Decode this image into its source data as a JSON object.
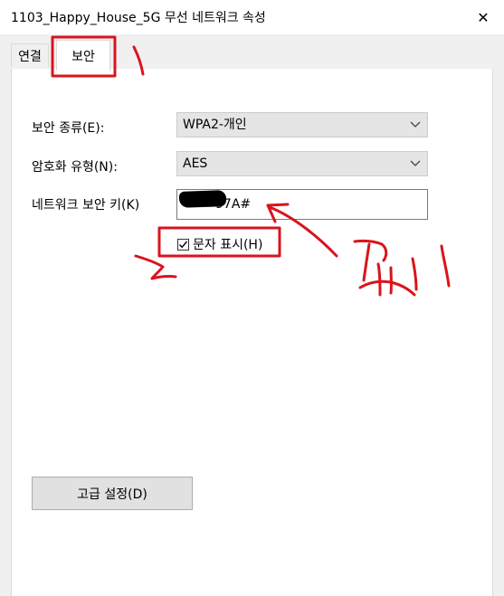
{
  "window": {
    "title": "1103_Happy_House_5G 무선 네트워크 속성",
    "close_glyph": "✕"
  },
  "tabs": [
    {
      "label": "연결",
      "selected": false
    },
    {
      "label": "보안",
      "selected": true
    }
  ],
  "security": {
    "type_label": "보안 종류(E):",
    "type_value": "WPA2-개인",
    "encryption_label": "암호화 유형(N):",
    "encryption_value": "AES",
    "key_label": "네트워크 보안 키(K)",
    "key_value": "97A#",
    "show_chars_label": "문자 표시(H)",
    "show_chars_checked": true
  },
  "advanced_button_label": "고급 설정(D)",
  "annotation": {
    "color": "#d9141c"
  },
  "colors": {
    "window_bg": "#f0f0f0",
    "panel_bg": "#ffffff",
    "select_bg": "#e5e5e5",
    "button_bg": "#e1e1e1"
  }
}
